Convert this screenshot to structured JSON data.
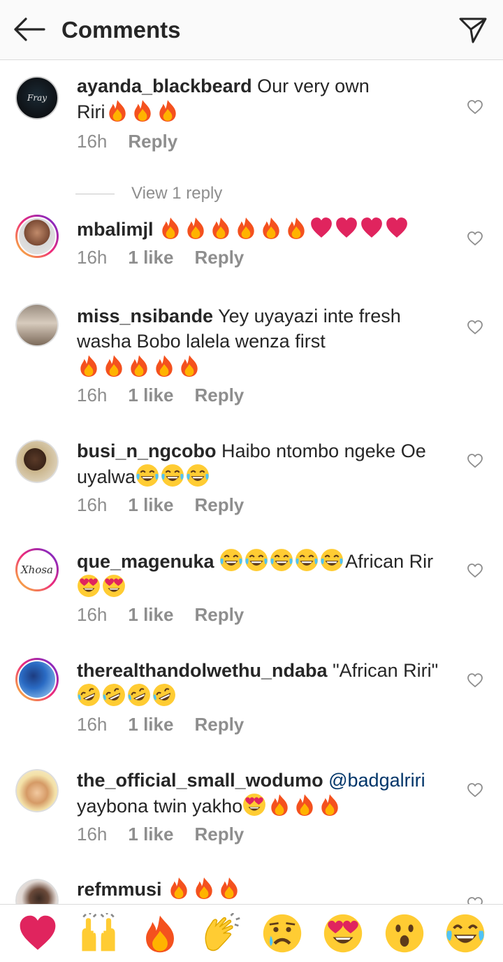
{
  "header": {
    "title": "Comments"
  },
  "comments": [
    {
      "user": "ayanda_blackbeard",
      "text": "Our very own Riri",
      "emojis": [
        "fire",
        "fire",
        "fire"
      ],
      "time": "16h",
      "likes": "",
      "reply": "Reply",
      "view_replies": "View 1 reply",
      "avatar_label": "Fray"
    },
    {
      "user": "mbalimjl",
      "text": "",
      "emojis": [
        "fire",
        "fire",
        "fire",
        "fire",
        "fire",
        "fire",
        "heart",
        "heart",
        "heart",
        "heart"
      ],
      "time": "16h",
      "likes": "1 like",
      "reply": "Reply"
    },
    {
      "user": "miss_nsibande",
      "text": "Yey uyayazi inte fresh washa Bobo lalela wenza first",
      "emojis": [
        "fire",
        "fire",
        "fire",
        "fire",
        "fire"
      ],
      "time": "16h",
      "likes": "1 like",
      "reply": "Reply"
    },
    {
      "user": "busi_n_ngcobo",
      "text": "Haibo ntombo ngeke Oe uyalwa",
      "emojis": [
        "joy",
        "joy",
        "joy"
      ],
      "time": "16h",
      "likes": "1 like",
      "reply": "Reply"
    },
    {
      "user": "que_magenuka",
      "text_pre_emojis": [
        "joy",
        "joy",
        "joy",
        "joy",
        "joy"
      ],
      "text": "African Rir",
      "emojis": [
        "hearteyes",
        "hearteyes"
      ],
      "time": "16h",
      "likes": "1 like",
      "reply": "Reply",
      "avatar_label": "Xhosa"
    },
    {
      "user": "therealthandolwethu_ndaba",
      "text": "\"African Riri\"",
      "emojis": [
        "rofl",
        "rofl",
        "rofl",
        "rofl"
      ],
      "time": "16h",
      "likes": "1 like",
      "reply": "Reply"
    },
    {
      "user": "the_official_small_wodumo",
      "mention": "@badgalriri",
      "text": "yaybona twin yakho",
      "emojis": [
        "hearteyes",
        "fire",
        "fire",
        "fire"
      ],
      "time": "16h",
      "likes": "1 like",
      "reply": "Reply"
    },
    {
      "user": "refmmusi",
      "text": "",
      "emojis": [
        "fire",
        "fire",
        "fire"
      ],
      "time": "",
      "likes": "",
      "reply": ""
    }
  ],
  "reactions": [
    "red-heart",
    "raising-hands",
    "fire",
    "clapping-hands",
    "crying-face",
    "heart-eyes",
    "astonished-face",
    "joy"
  ],
  "colors": {
    "fire_outer": "#f4511e",
    "fire_inner": "#ffb300",
    "heart": "#e0245e",
    "emoji_yellow": "#ffcc33",
    "meta_gray": "#8e8e8e"
  }
}
